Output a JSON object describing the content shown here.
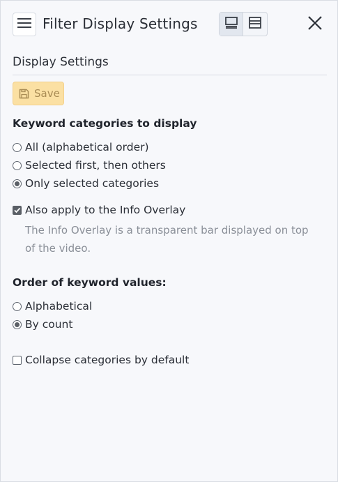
{
  "header": {
    "title": "Filter Display Settings",
    "menu_icon": "hamburger-menu-icon",
    "layout_icons": [
      "layout-bottom-panel-icon",
      "layout-split-icon"
    ],
    "close_icon": "close-icon"
  },
  "section": {
    "title": "Display Settings",
    "save_label": "Save",
    "save_icon": "floppy-disk-icon"
  },
  "keyword_categories": {
    "heading": "Keyword categories to display",
    "options": [
      {
        "label": "All (alphabetical order)",
        "checked": false
      },
      {
        "label": "Selected first, then others",
        "checked": false
      },
      {
        "label": "Only selected categories",
        "checked": true
      }
    ]
  },
  "info_overlay": {
    "label": "Also apply to the Info Overlay",
    "checked": true,
    "hint": "The Info Overlay is a transparent bar displayed on top of the video."
  },
  "keyword_order": {
    "heading": "Order of keyword values:",
    "options": [
      {
        "label": "Alphabetical",
        "checked": false
      },
      {
        "label": "By count",
        "checked": true
      }
    ]
  },
  "collapse": {
    "label": "Collapse categories by default",
    "checked": false
  },
  "colors": {
    "save_bg": "#fbe0a3",
    "save_text": "#a98c55",
    "background": "#f7f8fb"
  }
}
